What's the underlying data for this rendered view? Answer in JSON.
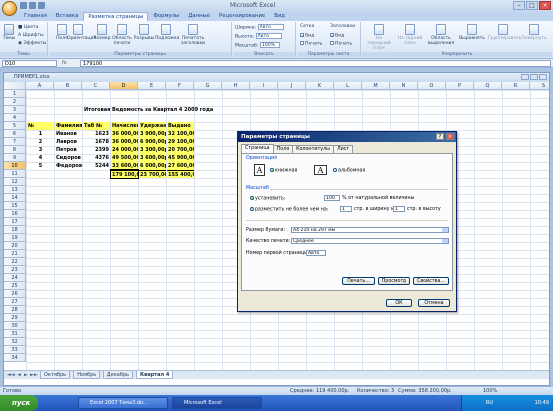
{
  "app": {
    "window_title": "Microsoft Excel",
    "tabs": [
      "Главная",
      "Вставка",
      "Разметка страницы",
      "Формулы",
      "Данные",
      "Рецензирование",
      "Вид"
    ],
    "active_tab_index": 2
  },
  "ribbon": {
    "themes": {
      "label": "Темы",
      "colors": "Цвета",
      "fonts": "Шрифты",
      "effects": "Эффекты",
      "big": "Темы"
    },
    "page_setup": {
      "label": "Параметры страницы",
      "buttons": [
        "Поля",
        "Ориентация",
        "Размер",
        "Область печати",
        "Разрывы",
        "Подложка",
        "Печатать заголовки"
      ]
    },
    "fit": {
      "label": "Вписать",
      "width": "Ширина:",
      "width_val": "Авто",
      "height": "Высота:",
      "height_val": "Авто",
      "scale": "Масштаб:",
      "scale_val": "100%"
    },
    "sheet_options": {
      "label": "Параметры листа",
      "grid": "Сетка",
      "headings": "Заголовки",
      "view": "Вид",
      "print": "Печать"
    },
    "arrange": {
      "label": "Упорядочить",
      "buttons": [
        "На передний план",
        "На задний план",
        "Область выделения",
        "Выровнять",
        "Группировать",
        "Повернуть"
      ]
    }
  },
  "formula_bar": {
    "cell_ref": "D10",
    "fx": "fx",
    "value": "179100"
  },
  "workbook": {
    "title": "ПРИМЕР1.xlsx"
  },
  "sheet": {
    "columns": [
      "A",
      "B",
      "C",
      "D",
      "E",
      "F",
      "G",
      "H",
      "I",
      "J",
      "K",
      "L",
      "M",
      "N",
      "O",
      "P",
      "Q",
      "R",
      "S"
    ],
    "rows": [
      "1",
      "2",
      "3",
      "4",
      "5",
      "6",
      "7",
      "8",
      "9",
      "10",
      "11",
      "12",
      "13",
      "14",
      "15",
      "16",
      "17",
      "18",
      "19",
      "20",
      "21",
      "22",
      "23",
      "24",
      "25",
      "26",
      "27",
      "28",
      "29",
      "30",
      "31",
      "32",
      "33",
      "34"
    ],
    "selected_col": "D",
    "selected_row": "10",
    "report_title": "Итоговая Ведомость за Квартал 4 2009 года",
    "headers": [
      "№",
      "Фамилия",
      "Таб №",
      "Начислено",
      "Удержано",
      "Выдано"
    ],
    "data_rows": [
      [
        "1",
        "Иванов",
        "1623",
        "36 000,00р.",
        "3 900,00р.",
        "32 100,00р."
      ],
      [
        "2",
        "Лавров",
        "1678",
        "36 000,00р.",
        "6 900,00р.",
        "29 100,00р."
      ],
      [
        "3",
        "Петров",
        "2399",
        "24 000,00р.",
        "3 300,00р.",
        "20 700,00р."
      ],
      [
        "4",
        "Сидоров",
        "4376",
        "49 500,00р.",
        "3 600,00р.",
        "45 900,00р."
      ],
      [
        "5",
        "Федоров",
        "5244",
        "33 600,00р.",
        "6 000,00р.",
        "27 600,00р."
      ]
    ],
    "totals": [
      "179 100,00р.",
      "23 700,00р.",
      "155 400,00р."
    ],
    "sheet_tabs": [
      "Октябрь",
      "Ноябрь",
      "Декабрь",
      "Квартал 4"
    ],
    "active_sheet_index": 3
  },
  "status": {
    "ready": "Готово",
    "average": "Среднее: 119 400,00р.",
    "count": "Количество: 3",
    "sum": "Сумма: 358 200,00р.",
    "zoom": "100%"
  },
  "taskbar": {
    "start": "пуск",
    "items": [
      "Excel 2007 Тема3.do...",
      "Microsoft Excel"
    ],
    "time": "10:49",
    "lang": "RU"
  },
  "dialog": {
    "title": "Параметры страницы",
    "tabs": [
      "Страница",
      "Поля",
      "Колонтитулы",
      "Лист"
    ],
    "active_tab_index": 0,
    "orientation_label": "Ориентация",
    "portrait": "книжная",
    "landscape": "альбомная",
    "scale_label": "Масштаб",
    "set_label": "установить:",
    "set_value": "100",
    "set_suffix": "% от натуральной величины",
    "fit_label": "разместить не более чем на:",
    "fit_w": "1",
    "fit_w_suffix": "стр. в ширину и",
    "fit_h": "1",
    "fit_h_suffix": "стр. в высоту",
    "paper_label": "Размер бумаги:",
    "paper_value": "A4 210 на 297 мм",
    "quality_label": "Качество печати:",
    "quality_value": "Среднее",
    "first_page_label": "Номер первой страницы:",
    "first_page_value": "Авто",
    "btn_print": "Печать...",
    "btn_preview": "Просмотр",
    "btn_props": "Свойства...",
    "btn_ok": "ОК",
    "btn_cancel": "Отмена",
    "orientation_selected": "portrait",
    "scale_selected": "set"
  }
}
